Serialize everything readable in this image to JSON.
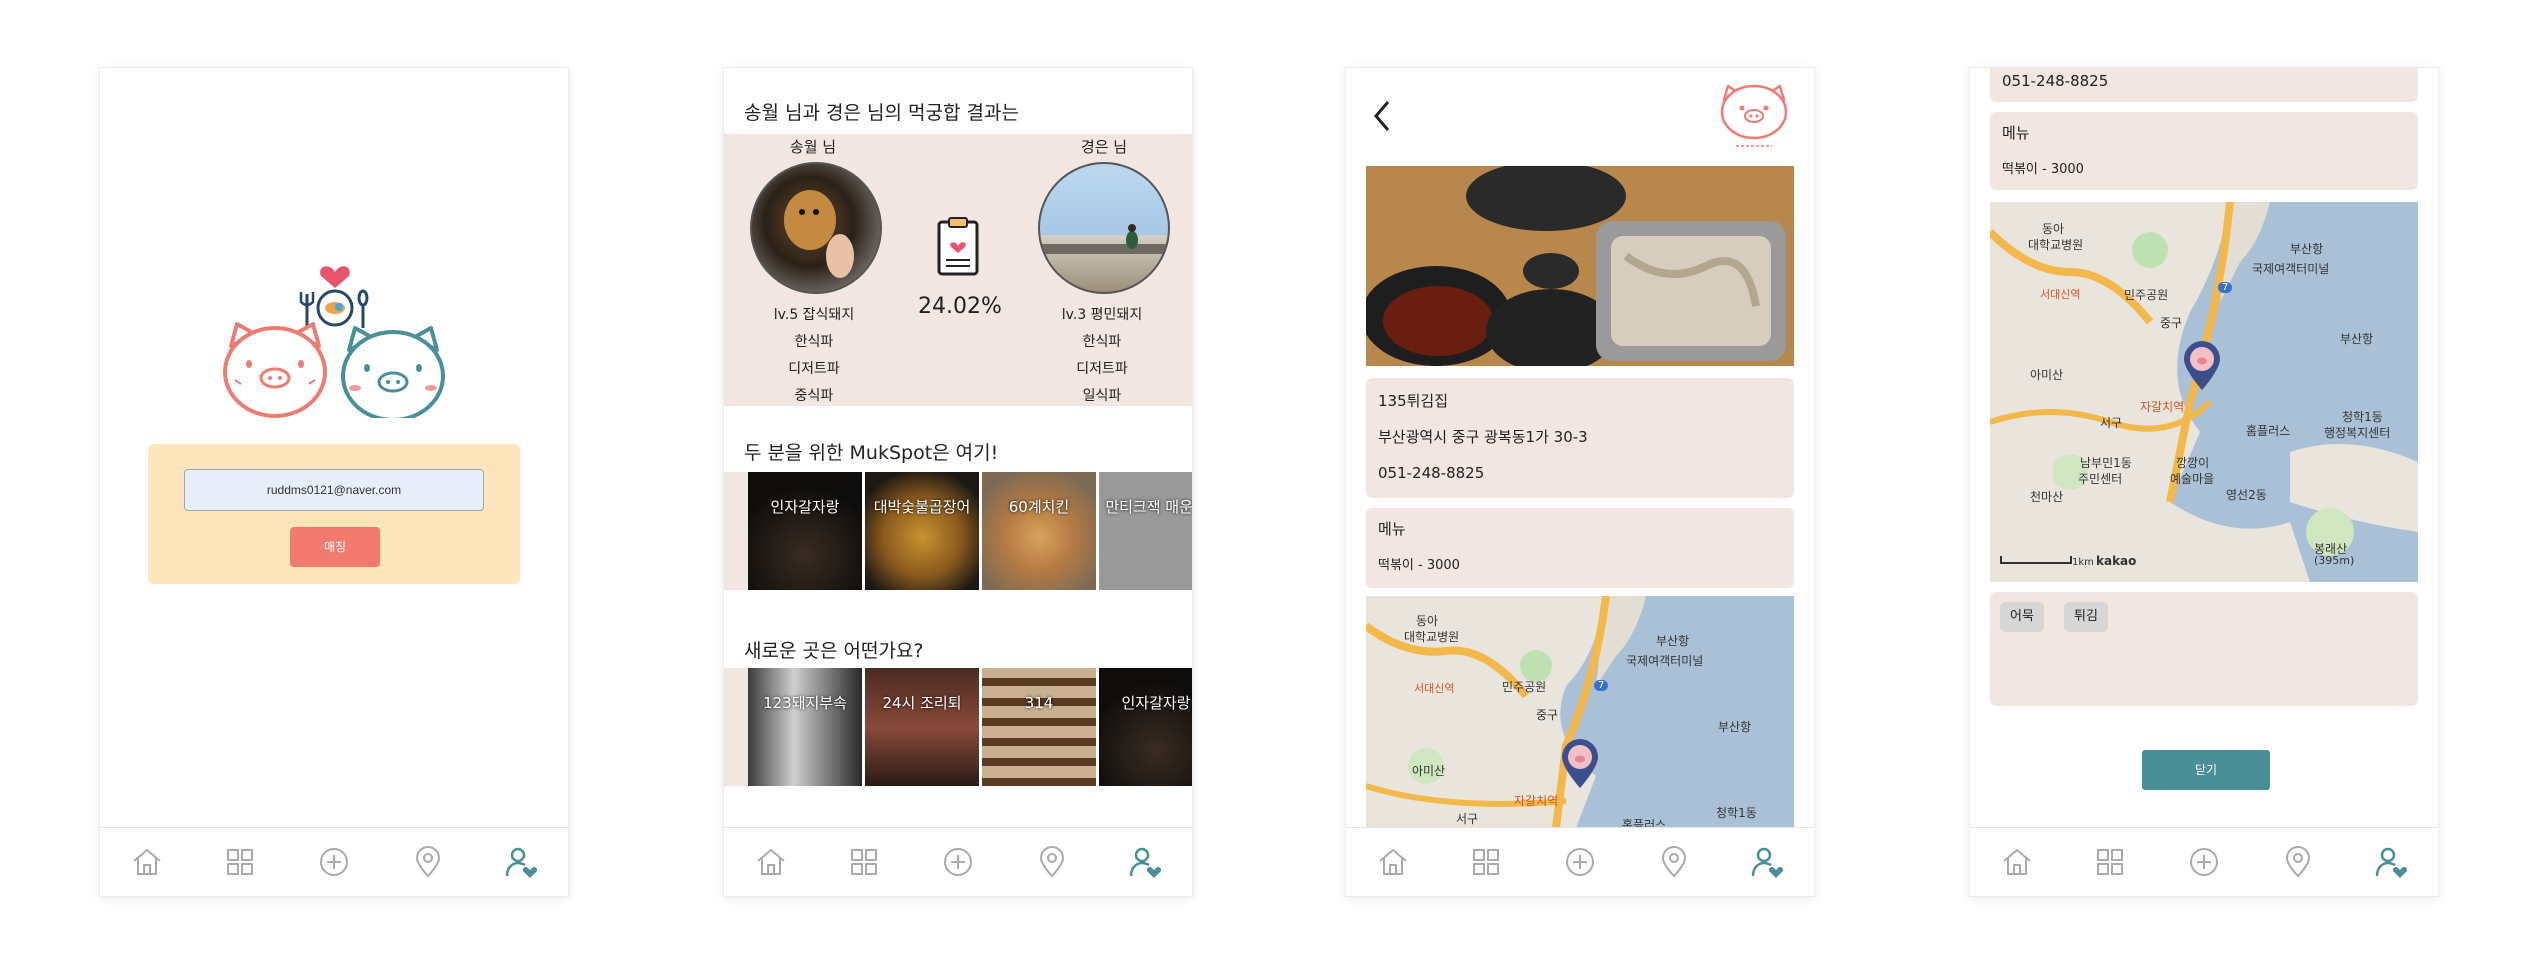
{
  "colors": {
    "pink": "#f37a6e",
    "teal": "#4a8e98",
    "card_bg": "#f1e6e1",
    "login_bg": "#fde5bc"
  },
  "tabs": [
    "home-icon",
    "grid-icon",
    "plus-circle-icon",
    "location-pin-icon",
    "user-heart-icon"
  ],
  "login": {
    "email_value": "ruddms0121@naver.com",
    "match_label": "매칭"
  },
  "match": {
    "title": "송월 님과 경은 님의 먹궁합 결과는",
    "left": {
      "name": "송월 님",
      "traits": [
        "lv.5 잡식돼지",
        "한식파",
        "디저트파",
        "중식파"
      ]
    },
    "right": {
      "name": "경은 님",
      "traits": [
        "lv.3 평민돼지",
        "한식파",
        "디저트파",
        "일식파"
      ]
    },
    "percent": "24.02%",
    "section_mukspot": "두 분을 위한 MukSpot은 여기!",
    "mukspot_places": [
      "인자갈자랑",
      "대박숯불곱장어",
      "60계치킨",
      "만티크잭 매운맛"
    ],
    "section_new": "새로운 곳은 어떤가요?",
    "new_places": [
      "123돼지부속",
      "24시 조리퇴",
      "314",
      "인자갈자랑"
    ]
  },
  "detail": {
    "name": "135튀김집",
    "address": "부산광역시 중구 광복동1가 30-3",
    "phone": "051-248-8825",
    "menu_label": "메뉴",
    "menu_item": "떡볶이 - 3000"
  },
  "map": {
    "labels_s3": [
      "동아",
      "대학교병원",
      "부산항",
      "국제여객터미널",
      "민주공원",
      "중구",
      "아미산",
      "부산항",
      "자갈치역",
      "청학1동",
      "서구",
      "홈플러스",
      "서대신역",
      "7"
    ],
    "labels_s4": [
      "동아",
      "대학교병원",
      "부산항",
      "국제여객터미널",
      "민주공원",
      "중구",
      "부산항",
      "아미산",
      "자갈치역",
      "서구",
      "홈플러스",
      "청학1동",
      "행정복지센터",
      "남부민1동",
      "주민센터",
      "깡깡이",
      "예술마을",
      "영선2동",
      "천마산",
      "봉래산",
      "(395m)",
      "1km",
      "kakao",
      "서대신역",
      "7"
    ]
  },
  "detail_bottom": {
    "phone": "051-248-8825",
    "menu_label": "메뉴",
    "menu_item": "떡볶이 - 3000",
    "tags": [
      "어묵",
      "튀김"
    ],
    "close_label": "닫기"
  }
}
